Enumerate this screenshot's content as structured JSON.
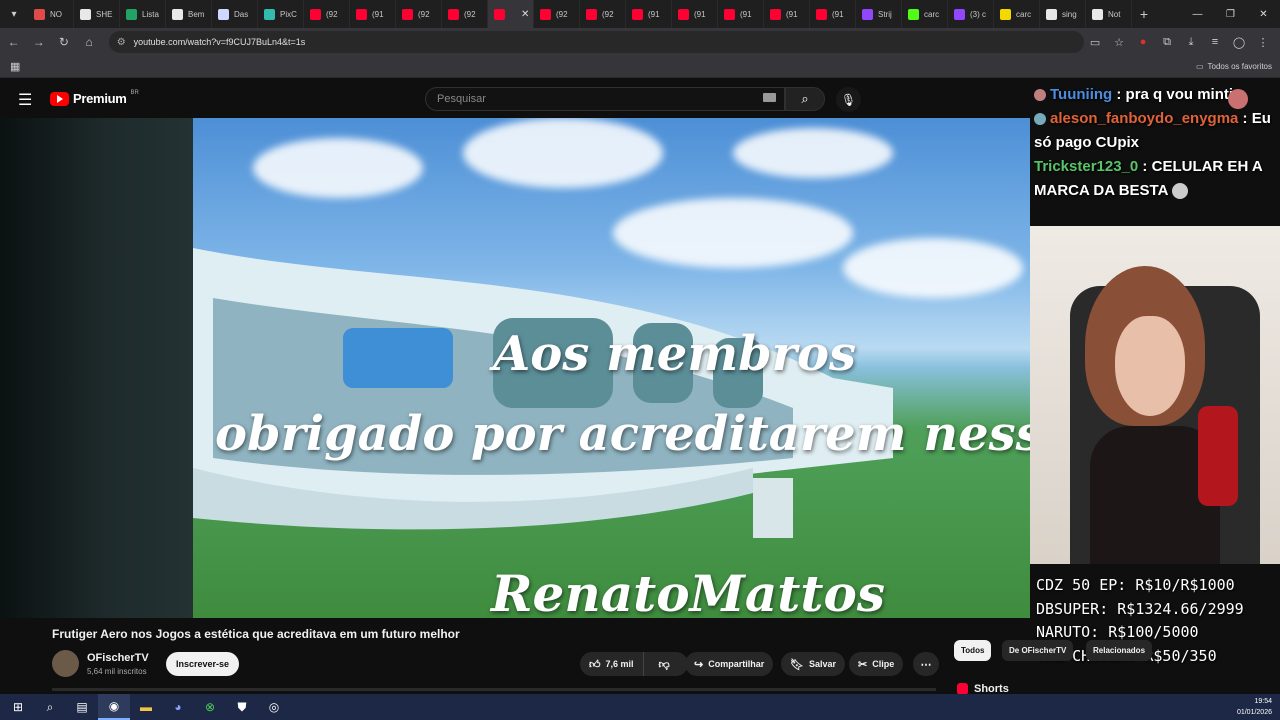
{
  "browser": {
    "tabs": [
      {
        "label": "NO",
        "color": "#e04a4a"
      },
      {
        "label": "SHE",
        "color": "#e8e8e8"
      },
      {
        "label": "Lista",
        "color": "#21a366"
      },
      {
        "label": "Bem",
        "color": "#e8e8e8"
      },
      {
        "label": "Das",
        "color": "#cfd8ff"
      },
      {
        "label": "PixC",
        "color": "#32bcad"
      },
      {
        "label": "(92",
        "color": "#ff0033"
      },
      {
        "label": "(91",
        "color": "#ff0033"
      },
      {
        "label": "(92",
        "color": "#ff0033"
      },
      {
        "label": "(92",
        "color": "#ff0033"
      },
      {
        "label": "",
        "color": "#ff0033",
        "active": true
      },
      {
        "label": "(92",
        "color": "#ff0033"
      },
      {
        "label": "(92",
        "color": "#ff0033"
      },
      {
        "label": "(91",
        "color": "#ff0033"
      },
      {
        "label": "(91",
        "color": "#ff0033"
      },
      {
        "label": "(91",
        "color": "#ff0033"
      },
      {
        "label": "(91",
        "color": "#ff0033"
      },
      {
        "label": "(91",
        "color": "#ff0033"
      },
      {
        "label": "Strij",
        "color": "#9146ff"
      },
      {
        "label": "carc",
        "color": "#53fc18"
      },
      {
        "label": "(3) c",
        "color": "#9146ff"
      },
      {
        "label": "carc",
        "color": "#f5d800"
      },
      {
        "label": "sing",
        "color": "#e8e8e8"
      },
      {
        "label": "Not",
        "color": "#e8e8e8"
      }
    ],
    "url": "youtube.com/watch?v=f9CUJ7BuLn4&t=1s",
    "bookmarks_all": "Todos os favoritos"
  },
  "youtube": {
    "logo_text": "Premium",
    "country": "BR",
    "search_placeholder": "Pesquisar"
  },
  "video": {
    "overlay_line1": "Aos membros",
    "overlay_line2": "obrigado por acreditarem nesse espa",
    "overlay_name": "RenatoMattos"
  },
  "chat": [
    {
      "user": "Tuuniing",
      "message": "pra q vou minti"
    },
    {
      "user": "aleson_fanboydo_enygma",
      "message": "Eu só pago CUpix"
    },
    {
      "user": "Trickster123_0",
      "message": "CELULAR EH A MARCA DA BESTA"
    }
  ],
  "prices": [
    "CDZ 50 EP: R$10/R$1000",
    "DBSUPER: R$1324.66/2999",
    "NARUTO: R$100/5000",
    "THE CHOSEN: R$50/350"
  ],
  "info": {
    "title": "Frutiger Aero nos Jogos a estética que acreditava em um futuro melhor",
    "channel": "OFischerTV",
    "subscribers": "5,64 mil inscritos",
    "subscribe_label": "Inscrever-se",
    "likes": "7,6 mil",
    "share_label": "Compartilhar",
    "save_label": "Salvar",
    "clip_label": "Clipe",
    "chips": [
      "Todos",
      "De OFischerTV",
      "Relacionados"
    ],
    "shorts_label": "Shorts"
  },
  "taskbar": {
    "time": "19:54",
    "date": "01/01/2026"
  }
}
